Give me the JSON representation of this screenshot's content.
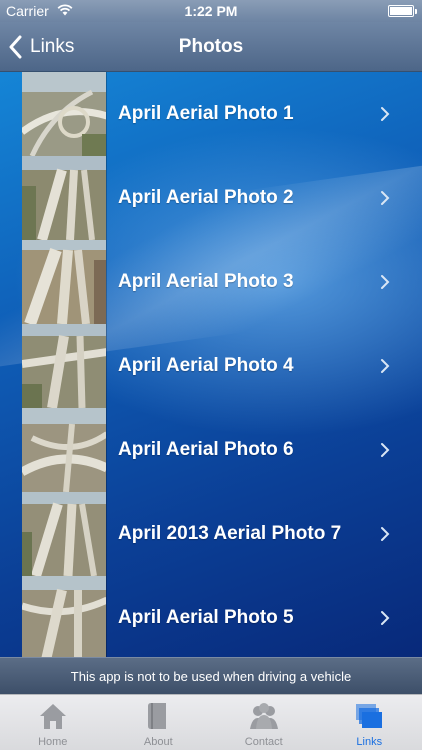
{
  "status_bar": {
    "carrier": "Carrier",
    "time": "1:22 PM",
    "battery_level": 1.0
  },
  "nav": {
    "back_label": "Links",
    "title": "Photos"
  },
  "photos": [
    {
      "label": "April Aerial Photo 1"
    },
    {
      "label": "April Aerial Photo 2"
    },
    {
      "label": "April Aerial Photo 3"
    },
    {
      "label": "April Aerial Photo 4"
    },
    {
      "label": "April Aerial Photo 6"
    },
    {
      "label": "April 2013 Aerial Photo 7"
    },
    {
      "label": "April Aerial Photo 5"
    }
  ],
  "disclaimer": "This app is not to be used when driving a vehicle",
  "tabs": [
    {
      "label": "Home",
      "icon": "home-icon",
      "active": false
    },
    {
      "label": "About",
      "icon": "book-icon",
      "active": false
    },
    {
      "label": "Contact",
      "icon": "people-icon",
      "active": false
    },
    {
      "label": "Links",
      "icon": "links-icon",
      "active": true
    }
  ],
  "colors": {
    "active_tab": "#1a6fe0",
    "inactive_tab": "#8e9095",
    "list_bg": "#0f5fb8"
  }
}
